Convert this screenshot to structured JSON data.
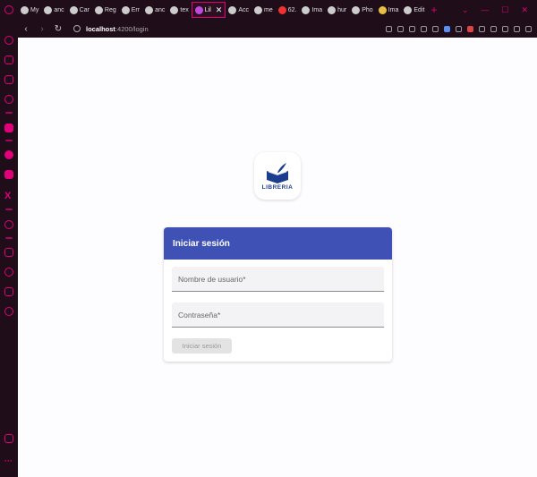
{
  "browser": {
    "tabs": [
      {
        "label": "My"
      },
      {
        "label": "anc"
      },
      {
        "label": "Car"
      },
      {
        "label": "Reg"
      },
      {
        "label": "Err"
      },
      {
        "label": "anc"
      },
      {
        "label": "tex"
      },
      {
        "label": "Lil",
        "active": true
      },
      {
        "label": "Acc"
      },
      {
        "label": "me"
      },
      {
        "label": "62."
      },
      {
        "label": "Ima"
      },
      {
        "label": "hur"
      },
      {
        "label": "Pho"
      },
      {
        "label": "Ima"
      },
      {
        "label": "Edit"
      }
    ],
    "url_host": "localhost",
    "url_path": ":4200/login"
  },
  "logo": {
    "text": "LIBRERIA"
  },
  "login": {
    "title": "Iniciar sesión",
    "username_placeholder": "Nombre de usuario*",
    "password_placeholder": "Contraseña*",
    "submit_label": "Iniciar sesión"
  },
  "colors": {
    "accent": "#e0007a",
    "card_header": "#3f51b5",
    "logo_blue": "#1a3d8f"
  }
}
